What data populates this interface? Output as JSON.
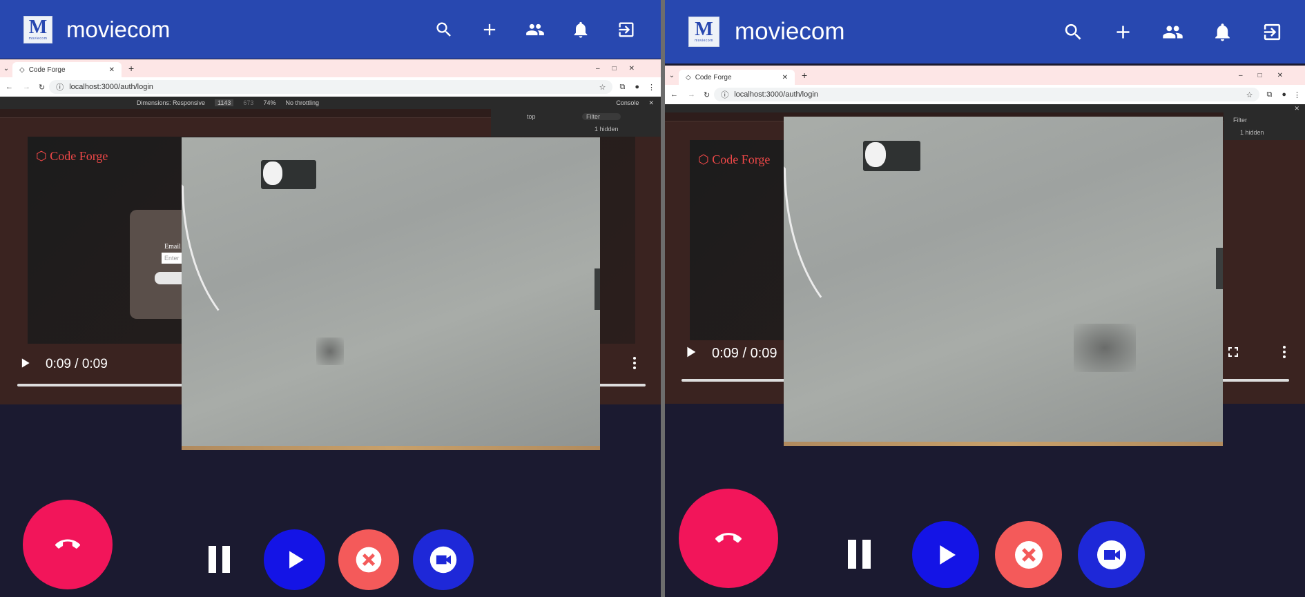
{
  "app": {
    "title": "moviecom",
    "logo_letter": "M",
    "logo_caption": "moviecom"
  },
  "browser": {
    "tab_title": "Code Forge",
    "url": "localhost:3000/auth/login",
    "devtools": {
      "dimensions_label": "Dimensions: Responsive",
      "width": "1143",
      "height": "673",
      "zoom": "74%",
      "throttling": "No throttling",
      "console_tab": "Console",
      "context": "top",
      "filter_placeholder": "Filter",
      "hidden_count": "1 hidden"
    }
  },
  "page": {
    "brand": "Code Forge",
    "email_label": "Email",
    "email_placeholder": "Enter"
  },
  "player_left": {
    "time": "0:09 / 0:09",
    "progress": 1.0
  },
  "player_right": {
    "time": "0:09 / 0:09",
    "progress": 1.0
  },
  "colors": {
    "appbar": "#2848b0",
    "background": "#1b1a30",
    "end_call": "#f2155a",
    "play": "#1414e6",
    "close": "#f45a5a",
    "camera": "#1e28d8"
  },
  "icons": [
    "search-icon",
    "add-icon",
    "people-icon",
    "bell-icon",
    "logout-icon",
    "play-icon",
    "fullscreen-icon",
    "more-icon",
    "end-call-icon",
    "pause-icon",
    "close-icon",
    "videocam-icon"
  ]
}
